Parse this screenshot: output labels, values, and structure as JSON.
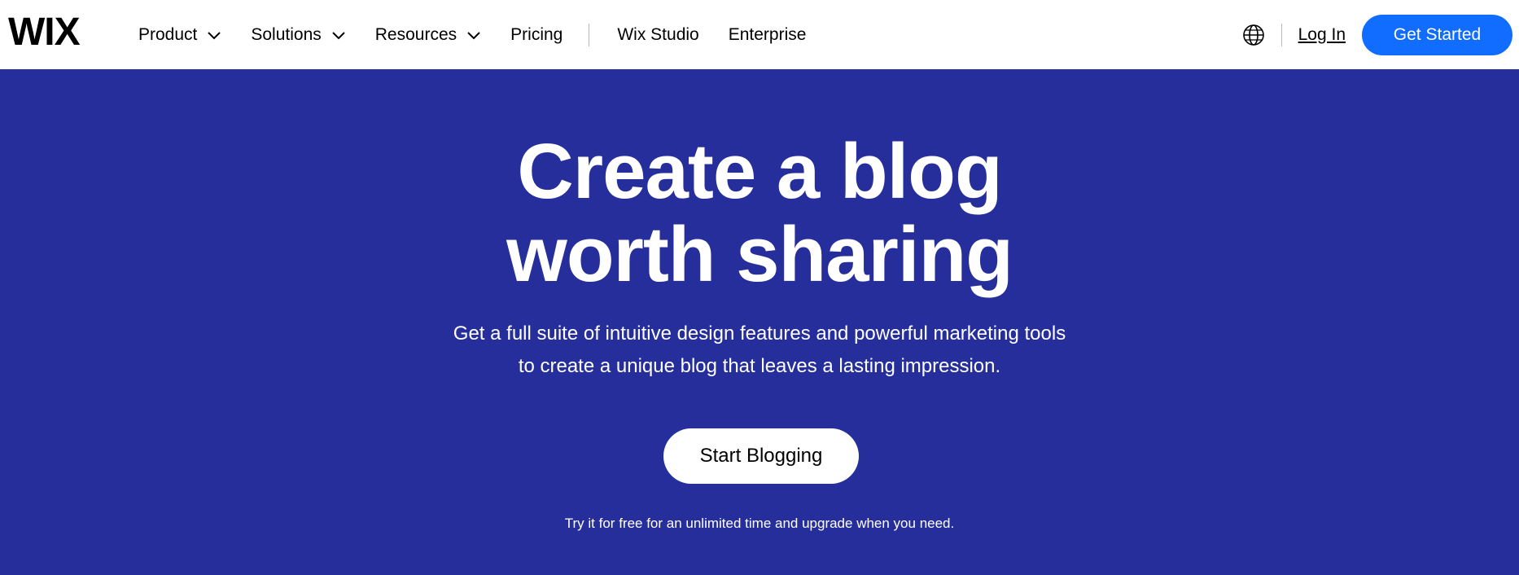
{
  "brand": {
    "logo_text": "WIX",
    "accent_color": "#116dff",
    "hero_bg": "#252e9b"
  },
  "nav": {
    "items": [
      {
        "label": "Product",
        "has_dropdown": true
      },
      {
        "label": "Solutions",
        "has_dropdown": true
      },
      {
        "label": "Resources",
        "has_dropdown": true
      },
      {
        "label": "Pricing",
        "has_dropdown": false
      }
    ],
    "secondary": [
      {
        "label": "Wix Studio"
      },
      {
        "label": "Enterprise"
      }
    ]
  },
  "header_right": {
    "language_icon": "globe-icon",
    "login_label": "Log In",
    "cta_label": "Get Started"
  },
  "hero": {
    "title_line1": "Create a blog",
    "title_line2": "worth sharing",
    "subtitle_line1": "Get a full suite of intuitive design features and powerful marketing tools",
    "subtitle_line2": "to create a unique blog that leaves a lasting impression.",
    "button_label": "Start Blogging",
    "note": "Try it for free for an unlimited time and upgrade when you need."
  }
}
